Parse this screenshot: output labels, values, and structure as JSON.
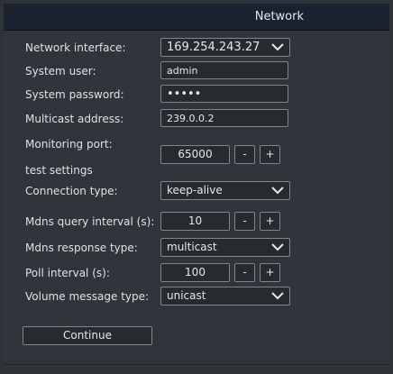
{
  "window": {
    "title": "Network"
  },
  "form": {
    "network_interface": {
      "label": "Network interface:",
      "value": "169.254.243.27"
    },
    "system_user": {
      "label": "System user:",
      "value": "admin"
    },
    "system_password": {
      "label": "System password:",
      "value": "•••••"
    },
    "multicast_address": {
      "label": "Multicast address:",
      "value": "239.0.0.2"
    },
    "monitoring_port": {
      "label": "Monitoring port:",
      "value": "65000",
      "minus": "-",
      "plus": "+"
    },
    "section_label": "test settings",
    "connection_type": {
      "label": "Connection type:",
      "value": "keep-alive"
    },
    "mdns_query_interval": {
      "label": "Mdns query interval (s):",
      "value": "10",
      "minus": "-",
      "plus": "+"
    },
    "mdns_response_type": {
      "label": "Mdns response type:",
      "value": "multicast"
    },
    "poll_interval": {
      "label": "Poll interval (s):",
      "value": "100",
      "minus": "-",
      "plus": "+"
    },
    "volume_message_type": {
      "label": "Volume message type:",
      "value": "unicast"
    }
  },
  "actions": {
    "continue_label": "Continue"
  },
  "icons": {
    "dropdown": "chevron-down-icon"
  },
  "colors": {
    "background": "#30353b",
    "titlebar": "#1a2230",
    "border": "#7f858c",
    "text": "#e6e8ea"
  }
}
